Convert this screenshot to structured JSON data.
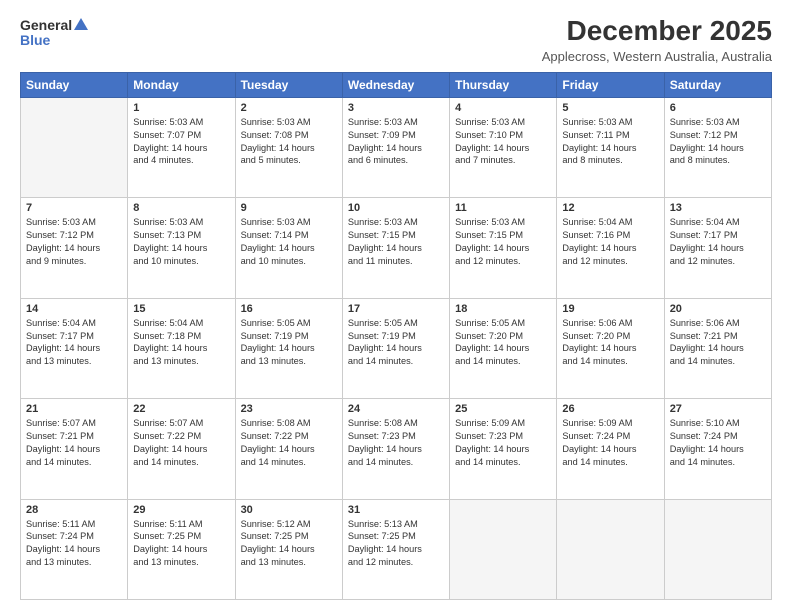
{
  "header": {
    "logo_general": "General",
    "logo_blue": "Blue",
    "main_title": "December 2025",
    "sub_title": "Applecross, Western Australia, Australia"
  },
  "calendar": {
    "days": [
      "Sunday",
      "Monday",
      "Tuesday",
      "Wednesday",
      "Thursday",
      "Friday",
      "Saturday"
    ],
    "rows": [
      [
        {
          "day": "",
          "lines": []
        },
        {
          "day": "1",
          "lines": [
            "Sunrise: 5:03 AM",
            "Sunset: 7:07 PM",
            "Daylight: 14 hours",
            "and 4 minutes."
          ]
        },
        {
          "day": "2",
          "lines": [
            "Sunrise: 5:03 AM",
            "Sunset: 7:08 PM",
            "Daylight: 14 hours",
            "and 5 minutes."
          ]
        },
        {
          "day": "3",
          "lines": [
            "Sunrise: 5:03 AM",
            "Sunset: 7:09 PM",
            "Daylight: 14 hours",
            "and 6 minutes."
          ]
        },
        {
          "day": "4",
          "lines": [
            "Sunrise: 5:03 AM",
            "Sunset: 7:10 PM",
            "Daylight: 14 hours",
            "and 7 minutes."
          ]
        },
        {
          "day": "5",
          "lines": [
            "Sunrise: 5:03 AM",
            "Sunset: 7:11 PM",
            "Daylight: 14 hours",
            "and 8 minutes."
          ]
        },
        {
          "day": "6",
          "lines": [
            "Sunrise: 5:03 AM",
            "Sunset: 7:12 PM",
            "Daylight: 14 hours",
            "and 8 minutes."
          ]
        }
      ],
      [
        {
          "day": "7",
          "lines": [
            "Sunrise: 5:03 AM",
            "Sunset: 7:12 PM",
            "Daylight: 14 hours",
            "and 9 minutes."
          ]
        },
        {
          "day": "8",
          "lines": [
            "Sunrise: 5:03 AM",
            "Sunset: 7:13 PM",
            "Daylight: 14 hours",
            "and 10 minutes."
          ]
        },
        {
          "day": "9",
          "lines": [
            "Sunrise: 5:03 AM",
            "Sunset: 7:14 PM",
            "Daylight: 14 hours",
            "and 10 minutes."
          ]
        },
        {
          "day": "10",
          "lines": [
            "Sunrise: 5:03 AM",
            "Sunset: 7:15 PM",
            "Daylight: 14 hours",
            "and 11 minutes."
          ]
        },
        {
          "day": "11",
          "lines": [
            "Sunrise: 5:03 AM",
            "Sunset: 7:15 PM",
            "Daylight: 14 hours",
            "and 12 minutes."
          ]
        },
        {
          "day": "12",
          "lines": [
            "Sunrise: 5:04 AM",
            "Sunset: 7:16 PM",
            "Daylight: 14 hours",
            "and 12 minutes."
          ]
        },
        {
          "day": "13",
          "lines": [
            "Sunrise: 5:04 AM",
            "Sunset: 7:17 PM",
            "Daylight: 14 hours",
            "and 12 minutes."
          ]
        }
      ],
      [
        {
          "day": "14",
          "lines": [
            "Sunrise: 5:04 AM",
            "Sunset: 7:17 PM",
            "Daylight: 14 hours",
            "and 13 minutes."
          ]
        },
        {
          "day": "15",
          "lines": [
            "Sunrise: 5:04 AM",
            "Sunset: 7:18 PM",
            "Daylight: 14 hours",
            "and 13 minutes."
          ]
        },
        {
          "day": "16",
          "lines": [
            "Sunrise: 5:05 AM",
            "Sunset: 7:19 PM",
            "Daylight: 14 hours",
            "and 13 minutes."
          ]
        },
        {
          "day": "17",
          "lines": [
            "Sunrise: 5:05 AM",
            "Sunset: 7:19 PM",
            "Daylight: 14 hours",
            "and 14 minutes."
          ]
        },
        {
          "day": "18",
          "lines": [
            "Sunrise: 5:05 AM",
            "Sunset: 7:20 PM",
            "Daylight: 14 hours",
            "and 14 minutes."
          ]
        },
        {
          "day": "19",
          "lines": [
            "Sunrise: 5:06 AM",
            "Sunset: 7:20 PM",
            "Daylight: 14 hours",
            "and 14 minutes."
          ]
        },
        {
          "day": "20",
          "lines": [
            "Sunrise: 5:06 AM",
            "Sunset: 7:21 PM",
            "Daylight: 14 hours",
            "and 14 minutes."
          ]
        }
      ],
      [
        {
          "day": "21",
          "lines": [
            "Sunrise: 5:07 AM",
            "Sunset: 7:21 PM",
            "Daylight: 14 hours",
            "and 14 minutes."
          ]
        },
        {
          "day": "22",
          "lines": [
            "Sunrise: 5:07 AM",
            "Sunset: 7:22 PM",
            "Daylight: 14 hours",
            "and 14 minutes."
          ]
        },
        {
          "day": "23",
          "lines": [
            "Sunrise: 5:08 AM",
            "Sunset: 7:22 PM",
            "Daylight: 14 hours",
            "and 14 minutes."
          ]
        },
        {
          "day": "24",
          "lines": [
            "Sunrise: 5:08 AM",
            "Sunset: 7:23 PM",
            "Daylight: 14 hours",
            "and 14 minutes."
          ]
        },
        {
          "day": "25",
          "lines": [
            "Sunrise: 5:09 AM",
            "Sunset: 7:23 PM",
            "Daylight: 14 hours",
            "and 14 minutes."
          ]
        },
        {
          "day": "26",
          "lines": [
            "Sunrise: 5:09 AM",
            "Sunset: 7:24 PM",
            "Daylight: 14 hours",
            "and 14 minutes."
          ]
        },
        {
          "day": "27",
          "lines": [
            "Sunrise: 5:10 AM",
            "Sunset: 7:24 PM",
            "Daylight: 14 hours",
            "and 14 minutes."
          ]
        }
      ],
      [
        {
          "day": "28",
          "lines": [
            "Sunrise: 5:11 AM",
            "Sunset: 7:24 PM",
            "Daylight: 14 hours",
            "and 13 minutes."
          ]
        },
        {
          "day": "29",
          "lines": [
            "Sunrise: 5:11 AM",
            "Sunset: 7:25 PM",
            "Daylight: 14 hours",
            "and 13 minutes."
          ]
        },
        {
          "day": "30",
          "lines": [
            "Sunrise: 5:12 AM",
            "Sunset: 7:25 PM",
            "Daylight: 14 hours",
            "and 13 minutes."
          ]
        },
        {
          "day": "31",
          "lines": [
            "Sunrise: 5:13 AM",
            "Sunset: 7:25 PM",
            "Daylight: 14 hours",
            "and 12 minutes."
          ]
        },
        {
          "day": "",
          "lines": []
        },
        {
          "day": "",
          "lines": []
        },
        {
          "day": "",
          "lines": []
        }
      ]
    ]
  }
}
